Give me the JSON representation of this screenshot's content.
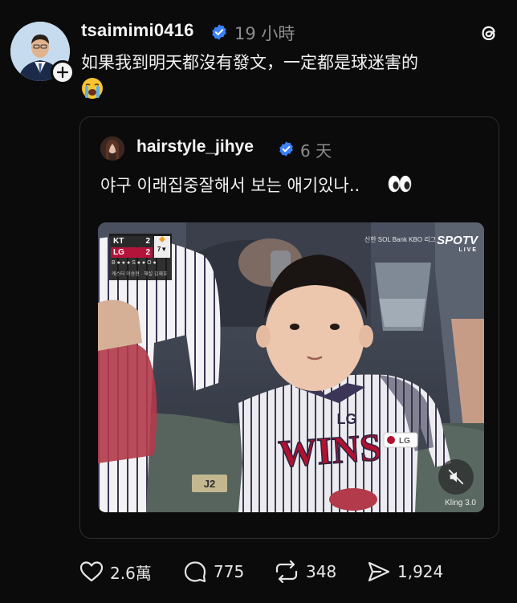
{
  "post": {
    "username": "tsaimimi0416",
    "time": "19 小時",
    "text": "如果我到明天都沒有發文，一定都是球迷害的",
    "emoji": "loudly-crying-face-emoji"
  },
  "quoted_post": {
    "username": "hairstyle_jihye",
    "time": "6 天",
    "text": "야구 이래집중잘해서 보는 애기있나..",
    "emoji": "eyes-emoji",
    "video": {
      "scoreboard": {
        "away_team": "KT",
        "away_score": "2",
        "home_team": "LG",
        "home_score": "2",
        "inning": "7▼",
        "count": "B ● ● ●  S ● ●  O ●",
        "caster": "캐스터 이승현 · 해설 김재호"
      },
      "league_text": "신한 SOL Bank KBO 리그",
      "broadcaster": "SPOTV",
      "broadcaster_sub": "LIVE",
      "jersey_text": "WINS",
      "jersey_logo": "LG",
      "seat_number": "J2",
      "watermark": "Kling 3.0"
    }
  },
  "actions": {
    "likes": "2.6萬",
    "replies": "775",
    "reposts": "348",
    "shares": "1,924"
  },
  "colors": {
    "background": "#0b0b0b",
    "verified": "#3b82f6",
    "muted_text": "#8d8d8d",
    "card_border": "#2f2f2f"
  },
  "icons": [
    "verified-badge-icon",
    "threads-logo-icon",
    "follow-plus-icon",
    "heart-icon",
    "reply-icon",
    "repost-icon",
    "share-icon",
    "mute-icon"
  ]
}
